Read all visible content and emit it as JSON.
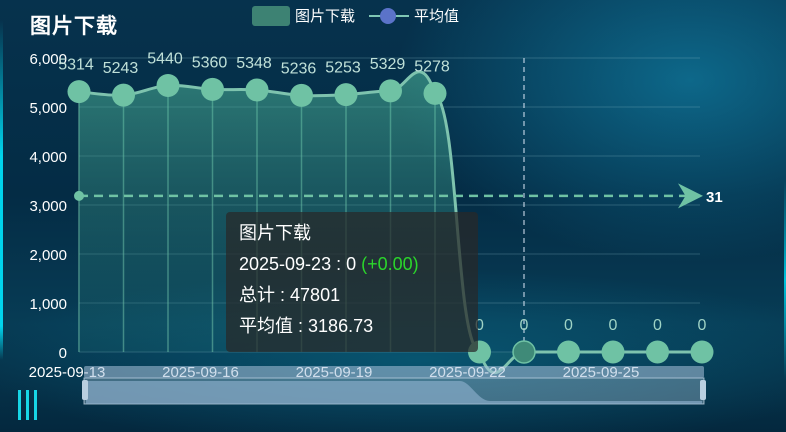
{
  "header": {
    "title": "图片下载"
  },
  "legend": {
    "series_label": "图片下载",
    "average_label": "平均值"
  },
  "tooltip": {
    "title": "图片下载",
    "date": "2025-09-23",
    "value": "0",
    "change": "(+0.00)",
    "total_label": "总计",
    "total_value": "47801",
    "avg_label": "平均值",
    "avg_value": "3186.73"
  },
  "average_marker": {
    "label": "31"
  },
  "colors": {
    "area_line": "#7ec3ae",
    "point": "#6fc2a4",
    "average_line": "#6fc2a4",
    "tooltip_green": "#2bd62b",
    "accent": "#17d6e6"
  },
  "chart_data": {
    "type": "area",
    "x": [
      "2025-09-13",
      "2025-09-14",
      "2025-09-15",
      "2025-09-16",
      "2025-09-17",
      "2025-09-18",
      "2025-09-19",
      "2025-09-20",
      "2025-09-21",
      "2025-09-22",
      "2025-09-23",
      "2025-09-24",
      "2025-09-25",
      "2025-09-26",
      "2025-09-27"
    ],
    "x_tick_labels": [
      "2025-09-13",
      "2025-09-16",
      "2025-09-19",
      "2025-09-22",
      "2025-09-25"
    ],
    "series": [
      {
        "name": "图片下载",
        "values": [
          5314,
          5243,
          5440,
          5360,
          5348,
          5236,
          5253,
          5329,
          5278,
          0,
          0,
          0,
          0,
          0,
          0
        ]
      }
    ],
    "average": 3186.73,
    "yticks": [
      "0",
      "1,000",
      "2,000",
      "3,000",
      "4,000",
      "5,000",
      "6,000"
    ],
    "ylim": [
      0,
      6000
    ],
    "grid": true,
    "legend_position": "top-center"
  }
}
